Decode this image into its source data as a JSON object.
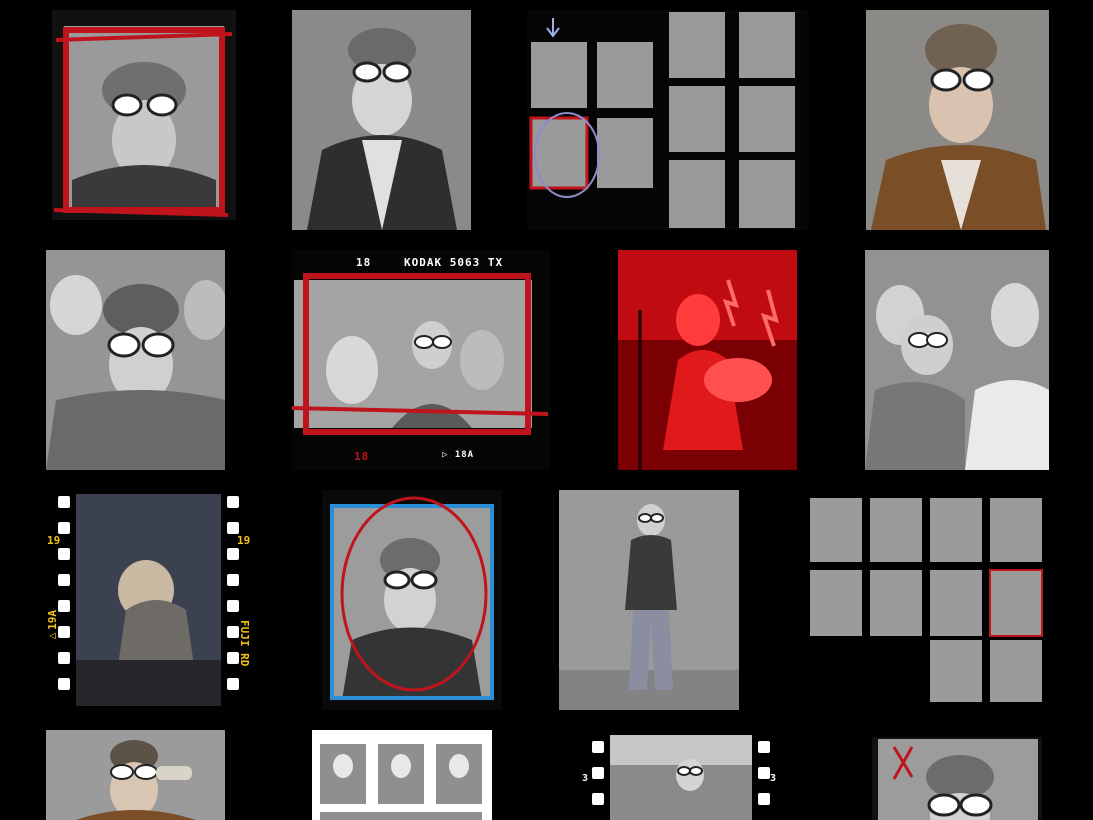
{
  "gallery": {
    "background": "#000000",
    "accent_red": "#c0141c",
    "accent_blue": "#2a8fd6",
    "film_yellow": "#f2c21a",
    "photos": [
      {
        "subject": "portrait-red-frame"
      },
      {
        "subject": "portrait-looking-up"
      },
      {
        "subject": "contact-sheet-pair"
      },
      {
        "subject": "portrait-color-smoking"
      },
      {
        "subject": "band-trio-hats"
      },
      {
        "subject": "street-crowd-kodak"
      },
      {
        "subject": "red-stage-guitar"
      },
      {
        "subject": "band-trio-grey"
      },
      {
        "subject": "fuji-film-strip"
      },
      {
        "subject": "portrait-blue-red-marks"
      },
      {
        "subject": "full-body-standing"
      },
      {
        "subject": "contact-sheet-grid"
      },
      {
        "subject": "portrait-drinking"
      },
      {
        "subject": "contact-sheet-white"
      },
      {
        "subject": "street-film-strip"
      },
      {
        "subject": "portrait-red-x"
      }
    ],
    "film_labels": {
      "kodak_num": "18",
      "kodak_brand": "KODAK 5063 TX",
      "kodak_bottom_num": "18",
      "kodak_bottom_mark": "▷ 18A",
      "fuji_num_left_top": "19",
      "fuji_num_right_top": "19",
      "fuji_mark_left": "▷19A",
      "fuji_brand": "FUJI RD",
      "street_num_left": "3",
      "street_num_right": "3"
    }
  }
}
